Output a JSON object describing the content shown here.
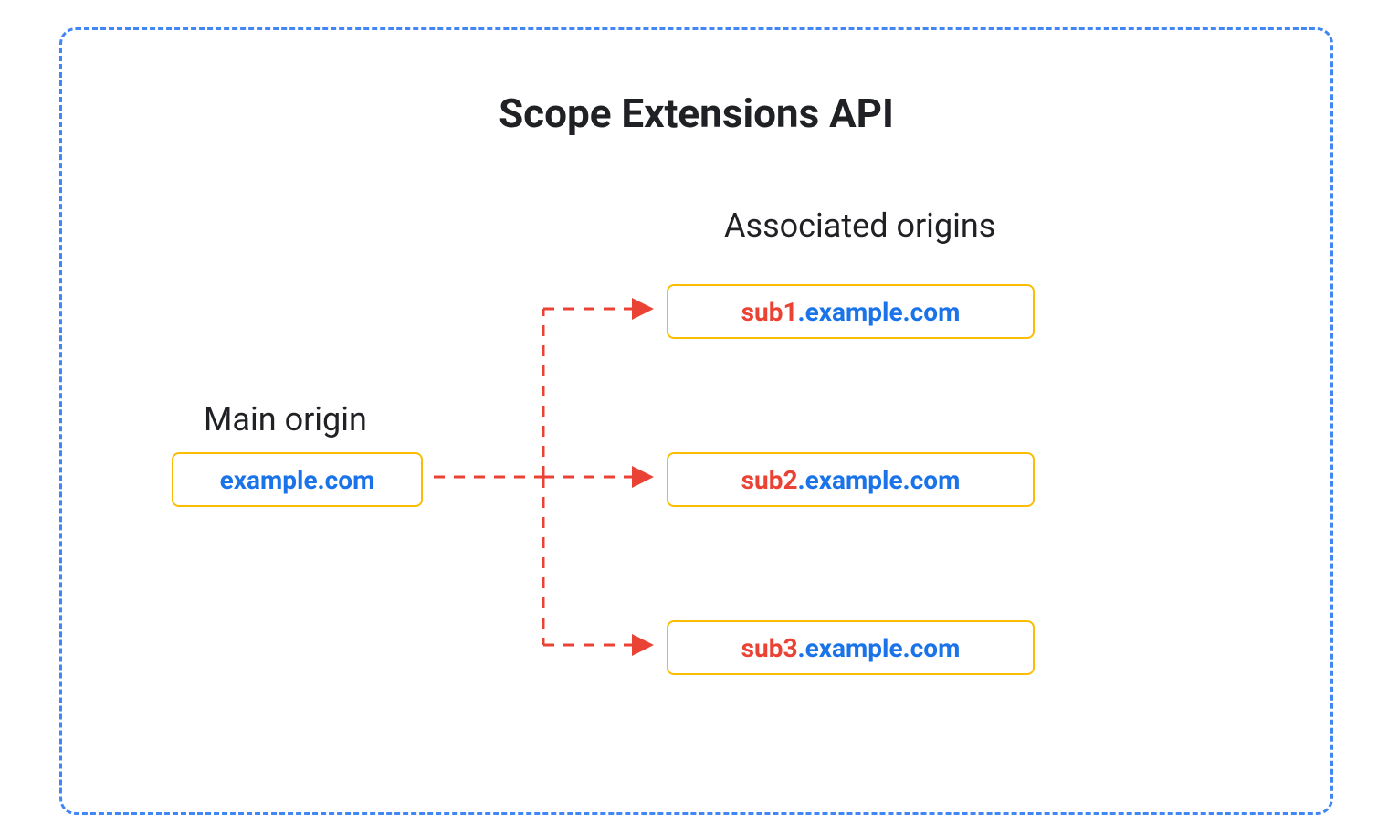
{
  "title": "Scope Extensions API",
  "main_origin": {
    "label": "Main origin",
    "domain": "example.com"
  },
  "associated": {
    "label": "Associated origins",
    "items": [
      {
        "sub": "sub1",
        "dot": ".",
        "domain": "example.com"
      },
      {
        "sub": "sub2",
        "dot": ".",
        "domain": "example.com"
      },
      {
        "sub": "sub3",
        "dot": ".",
        "domain": "example.com"
      }
    ]
  },
  "colors": {
    "border_dashed": "#4285F4",
    "box_border": "#FBBC04",
    "text_title": "#202124",
    "text_blue": "#1A73E8",
    "text_red": "#EA4335",
    "arrow": "#EA4335"
  }
}
